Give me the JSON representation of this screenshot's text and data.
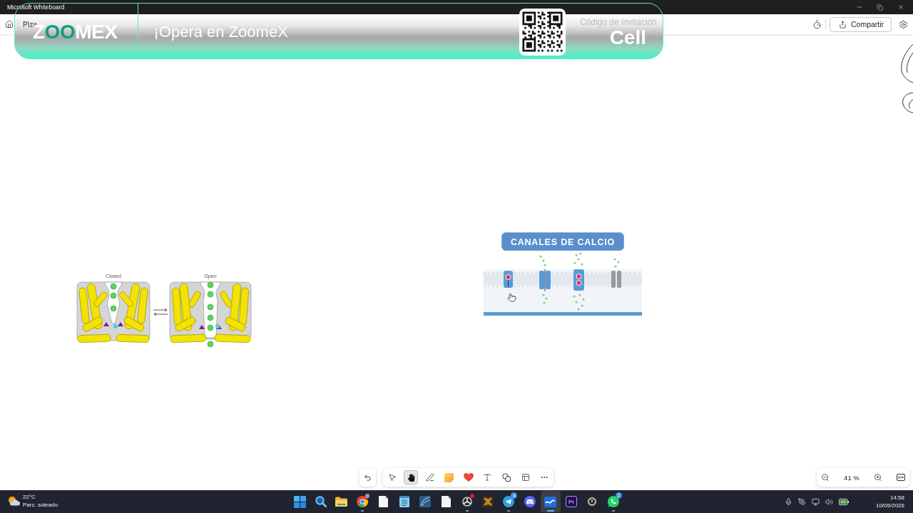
{
  "window": {
    "title": "Microsoft Whiteboard"
  },
  "header": {
    "board_title": "Piza",
    "share_button": "Compartir"
  },
  "banner": {
    "logo": {
      "start": "Z",
      "accent": "OO",
      "end": "MEX"
    },
    "slogan": "¡Opera en ZoomeX",
    "invite_label": "Código de invitación",
    "code": "Cell"
  },
  "canvas": {
    "images": [
      {
        "kind": "gating-diagram",
        "labels": [
          "Closed",
          "Open"
        ]
      },
      {
        "kind": "calcium-channels",
        "title": "CANALES DE CALCIO"
      }
    ]
  },
  "toolbar": {
    "tools": [
      {
        "kind": "select",
        "selected": false
      },
      {
        "kind": "hand",
        "selected": true
      },
      {
        "kind": "pen",
        "selected": false
      },
      {
        "kind": "sticky-note",
        "selected": false
      },
      {
        "kind": "reaction",
        "selected": false
      },
      {
        "kind": "text",
        "selected": false
      },
      {
        "kind": "shapes",
        "selected": false
      },
      {
        "kind": "templates",
        "selected": false
      },
      {
        "kind": "more",
        "selected": false
      }
    ]
  },
  "zoom": {
    "value": "41 %"
  },
  "taskbar": {
    "weather": {
      "temperature": "22°C",
      "condition": "Parc. soleado"
    },
    "apps": [
      {
        "kind": "start",
        "running": false,
        "selected": false
      },
      {
        "kind": "search",
        "running": false,
        "selected": false
      },
      {
        "kind": "folder",
        "running": false,
        "selected": false
      },
      {
        "kind": "browser",
        "running": true,
        "selected": false,
        "color": "#9aa0a6"
      },
      {
        "kind": "document",
        "running": false,
        "selected": false
      },
      {
        "kind": "notepad",
        "running": false,
        "selected": false
      },
      {
        "kind": "editor",
        "running": false,
        "selected": false
      },
      {
        "kind": "document",
        "running": false,
        "selected": false
      },
      {
        "kind": "recorder",
        "running": true,
        "selected": false,
        "color": "#e81123"
      },
      {
        "kind": "game",
        "running": false,
        "selected": false
      },
      {
        "kind": "messenger",
        "running": true,
        "selected": false,
        "badge": "4"
      },
      {
        "kind": "chat",
        "running": false,
        "selected": false
      },
      {
        "kind": "board",
        "running": true,
        "selected": true
      },
      {
        "kind": "video-editor",
        "running": false,
        "selected": false,
        "label": "Pr"
      },
      {
        "kind": "wallet",
        "running": false,
        "selected": false
      },
      {
        "kind": "phone",
        "running": true,
        "selected": false,
        "badge": "2"
      }
    ],
    "clock": {
      "time": "14:58",
      "date": "10/05/2026"
    }
  }
}
